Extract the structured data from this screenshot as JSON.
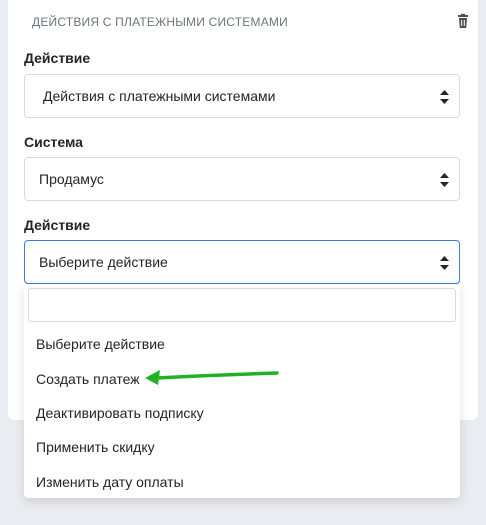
{
  "card": {
    "title": "Действия с платежными системами",
    "delete_icon": "trash-icon"
  },
  "fields": [
    {
      "label": "Действие",
      "value": "Действия с платежными системами"
    },
    {
      "label": "Система",
      "value": "Продамус"
    },
    {
      "label": "Действие",
      "value": "Выберите действие"
    }
  ],
  "dropdown": {
    "search_value": "",
    "options": [
      "Выберите действие",
      "Создать платеж",
      "Деактивировать подписку",
      "Применить скидку",
      "Изменить дату оплаты"
    ]
  },
  "annotation": {
    "arrow_color": "#22b026",
    "points_to": "Создать платеж"
  },
  "colors": {
    "focus_border": "#3b7ddd",
    "background": "#e9ecf0"
  }
}
